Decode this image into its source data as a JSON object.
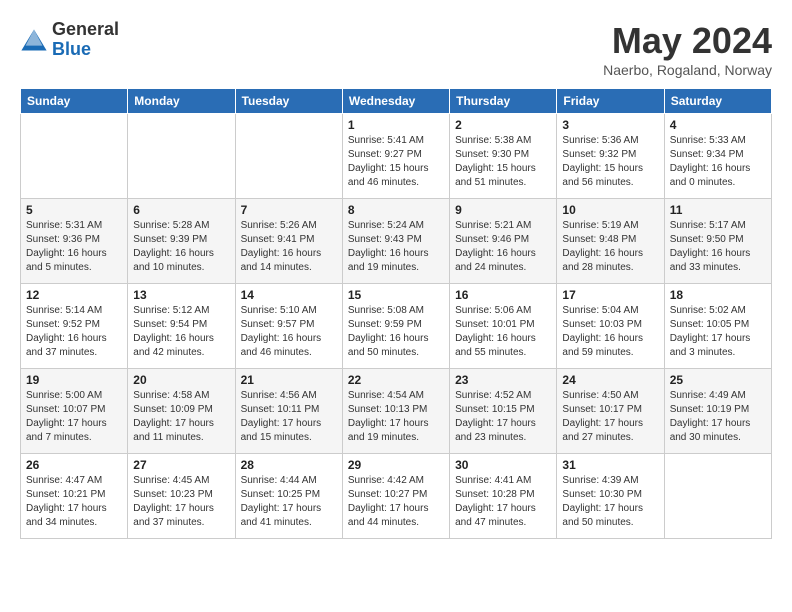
{
  "header": {
    "logo": {
      "line1": "General",
      "line2": "Blue"
    },
    "title": "May 2024",
    "location": "Naerbo, Rogaland, Norway"
  },
  "calendar": {
    "days_of_week": [
      "Sunday",
      "Monday",
      "Tuesday",
      "Wednesday",
      "Thursday",
      "Friday",
      "Saturday"
    ],
    "weeks": [
      [
        {
          "day": "",
          "info": ""
        },
        {
          "day": "",
          "info": ""
        },
        {
          "day": "",
          "info": ""
        },
        {
          "day": "1",
          "info": "Sunrise: 5:41 AM\nSunset: 9:27 PM\nDaylight: 15 hours\nand 46 minutes."
        },
        {
          "day": "2",
          "info": "Sunrise: 5:38 AM\nSunset: 9:30 PM\nDaylight: 15 hours\nand 51 minutes."
        },
        {
          "day": "3",
          "info": "Sunrise: 5:36 AM\nSunset: 9:32 PM\nDaylight: 15 hours\nand 56 minutes."
        },
        {
          "day": "4",
          "info": "Sunrise: 5:33 AM\nSunset: 9:34 PM\nDaylight: 16 hours\nand 0 minutes."
        }
      ],
      [
        {
          "day": "5",
          "info": "Sunrise: 5:31 AM\nSunset: 9:36 PM\nDaylight: 16 hours\nand 5 minutes."
        },
        {
          "day": "6",
          "info": "Sunrise: 5:28 AM\nSunset: 9:39 PM\nDaylight: 16 hours\nand 10 minutes."
        },
        {
          "day": "7",
          "info": "Sunrise: 5:26 AM\nSunset: 9:41 PM\nDaylight: 16 hours\nand 14 minutes."
        },
        {
          "day": "8",
          "info": "Sunrise: 5:24 AM\nSunset: 9:43 PM\nDaylight: 16 hours\nand 19 minutes."
        },
        {
          "day": "9",
          "info": "Sunrise: 5:21 AM\nSunset: 9:46 PM\nDaylight: 16 hours\nand 24 minutes."
        },
        {
          "day": "10",
          "info": "Sunrise: 5:19 AM\nSunset: 9:48 PM\nDaylight: 16 hours\nand 28 minutes."
        },
        {
          "day": "11",
          "info": "Sunrise: 5:17 AM\nSunset: 9:50 PM\nDaylight: 16 hours\nand 33 minutes."
        }
      ],
      [
        {
          "day": "12",
          "info": "Sunrise: 5:14 AM\nSunset: 9:52 PM\nDaylight: 16 hours\nand 37 minutes."
        },
        {
          "day": "13",
          "info": "Sunrise: 5:12 AM\nSunset: 9:54 PM\nDaylight: 16 hours\nand 42 minutes."
        },
        {
          "day": "14",
          "info": "Sunrise: 5:10 AM\nSunset: 9:57 PM\nDaylight: 16 hours\nand 46 minutes."
        },
        {
          "day": "15",
          "info": "Sunrise: 5:08 AM\nSunset: 9:59 PM\nDaylight: 16 hours\nand 50 minutes."
        },
        {
          "day": "16",
          "info": "Sunrise: 5:06 AM\nSunset: 10:01 PM\nDaylight: 16 hours\nand 55 minutes."
        },
        {
          "day": "17",
          "info": "Sunrise: 5:04 AM\nSunset: 10:03 PM\nDaylight: 16 hours\nand 59 minutes."
        },
        {
          "day": "18",
          "info": "Sunrise: 5:02 AM\nSunset: 10:05 PM\nDaylight: 17 hours\nand 3 minutes."
        }
      ],
      [
        {
          "day": "19",
          "info": "Sunrise: 5:00 AM\nSunset: 10:07 PM\nDaylight: 17 hours\nand 7 minutes."
        },
        {
          "day": "20",
          "info": "Sunrise: 4:58 AM\nSunset: 10:09 PM\nDaylight: 17 hours\nand 11 minutes."
        },
        {
          "day": "21",
          "info": "Sunrise: 4:56 AM\nSunset: 10:11 PM\nDaylight: 17 hours\nand 15 minutes."
        },
        {
          "day": "22",
          "info": "Sunrise: 4:54 AM\nSunset: 10:13 PM\nDaylight: 17 hours\nand 19 minutes."
        },
        {
          "day": "23",
          "info": "Sunrise: 4:52 AM\nSunset: 10:15 PM\nDaylight: 17 hours\nand 23 minutes."
        },
        {
          "day": "24",
          "info": "Sunrise: 4:50 AM\nSunset: 10:17 PM\nDaylight: 17 hours\nand 27 minutes."
        },
        {
          "day": "25",
          "info": "Sunrise: 4:49 AM\nSunset: 10:19 PM\nDaylight: 17 hours\nand 30 minutes."
        }
      ],
      [
        {
          "day": "26",
          "info": "Sunrise: 4:47 AM\nSunset: 10:21 PM\nDaylight: 17 hours\nand 34 minutes."
        },
        {
          "day": "27",
          "info": "Sunrise: 4:45 AM\nSunset: 10:23 PM\nDaylight: 17 hours\nand 37 minutes."
        },
        {
          "day": "28",
          "info": "Sunrise: 4:44 AM\nSunset: 10:25 PM\nDaylight: 17 hours\nand 41 minutes."
        },
        {
          "day": "29",
          "info": "Sunrise: 4:42 AM\nSunset: 10:27 PM\nDaylight: 17 hours\nand 44 minutes."
        },
        {
          "day": "30",
          "info": "Sunrise: 4:41 AM\nSunset: 10:28 PM\nDaylight: 17 hours\nand 47 minutes."
        },
        {
          "day": "31",
          "info": "Sunrise: 4:39 AM\nSunset: 10:30 PM\nDaylight: 17 hours\nand 50 minutes."
        },
        {
          "day": "",
          "info": ""
        }
      ]
    ]
  }
}
